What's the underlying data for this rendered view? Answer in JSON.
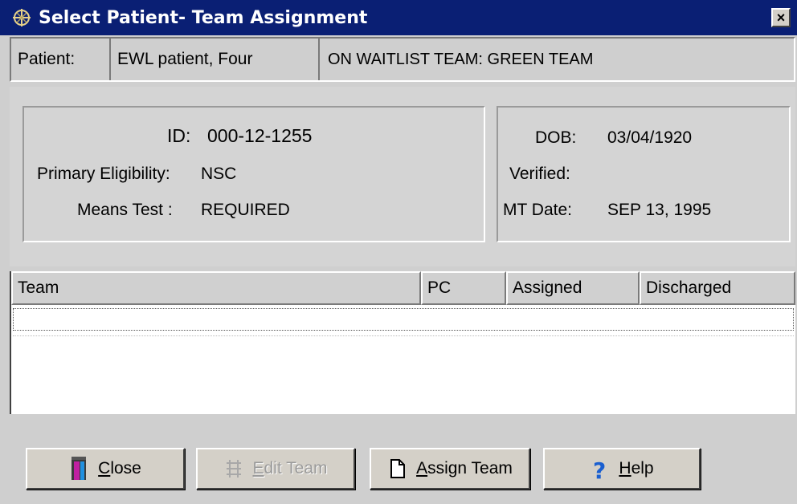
{
  "window": {
    "title": "Select Patient- Team Assignment",
    "close_glyph": "×"
  },
  "patient": {
    "label": "Patient:",
    "name": "EWL patient, Four",
    "waitlist": "ON WAITLIST TEAM: GREEN TEAM"
  },
  "details": {
    "id_label": "ID:",
    "id_value": "000-12-1255",
    "eligibility_label": "Primary Eligibility:",
    "eligibility_value": "NSC",
    "means_label": "Means Test :",
    "means_value": "REQUIRED",
    "dob_label": "DOB:",
    "dob_value": "03/04/1920",
    "verified_label": "Verified:",
    "verified_value": "",
    "mtdate_label": "MT Date:",
    "mtdate_value": "SEP 13, 1995"
  },
  "table": {
    "columns": [
      "Team",
      "PC",
      "Assigned",
      "Discharged"
    ],
    "rows": []
  },
  "buttons": {
    "close": {
      "mnemonic": "C",
      "rest": "lose",
      "icon": "door-icon"
    },
    "edit_team": {
      "mnemonic": "E",
      "rest": "dit Team",
      "icon": "edit-team-icon",
      "disabled": true
    },
    "assign_team": {
      "mnemonic": "A",
      "rest": "ssign Team",
      "icon": "new-document-icon"
    },
    "help": {
      "mnemonic": "H",
      "rest": "elp",
      "icon": "question-mark-icon"
    }
  }
}
